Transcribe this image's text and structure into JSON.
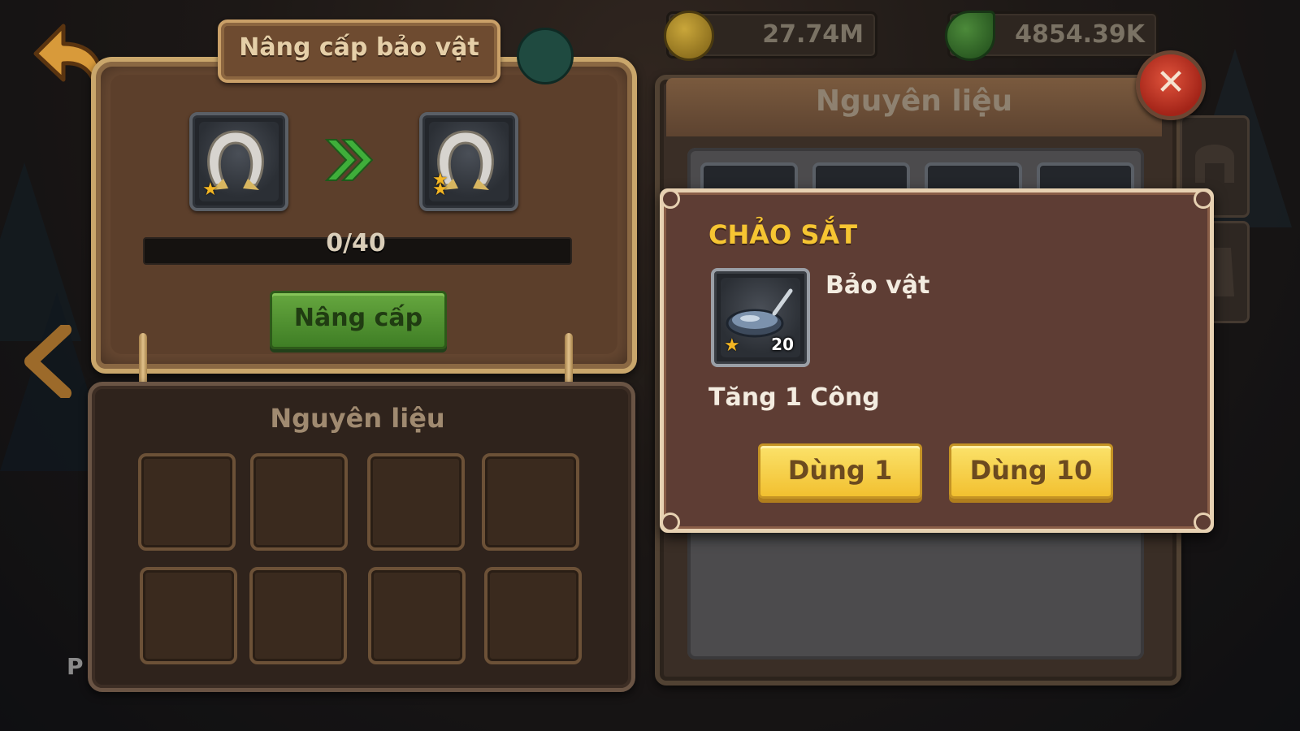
{
  "resources": {
    "gold": {
      "value": "27.74M",
      "icon": "gold-coin-icon"
    },
    "leaf": {
      "value": "4854.39K",
      "icon": "green-leaf-icon"
    }
  },
  "upgrade": {
    "title": "Nâng cấp bảo vật",
    "progress_text": "0/40",
    "progress_fraction": 0,
    "upgrade_button": "Nâng cấp",
    "materials_title": "Nguyên liệu"
  },
  "inventory": {
    "title": "Nguyên liệu",
    "close_icon": "close-icon"
  },
  "popup": {
    "item_name": "CHẢO SẮT",
    "item_type": "Bảo vật",
    "item_count": "20",
    "item_effect": "Tăng 1 Công",
    "use_one_button": "Dùng 1",
    "use_ten_button": "Dùng 10"
  },
  "partial_label": "P",
  "colors": {
    "title_yellow": "#f6c532",
    "button_yellow": "#f2c030",
    "button_green": "#4f8f2e",
    "close_red": "#c1311f"
  }
}
